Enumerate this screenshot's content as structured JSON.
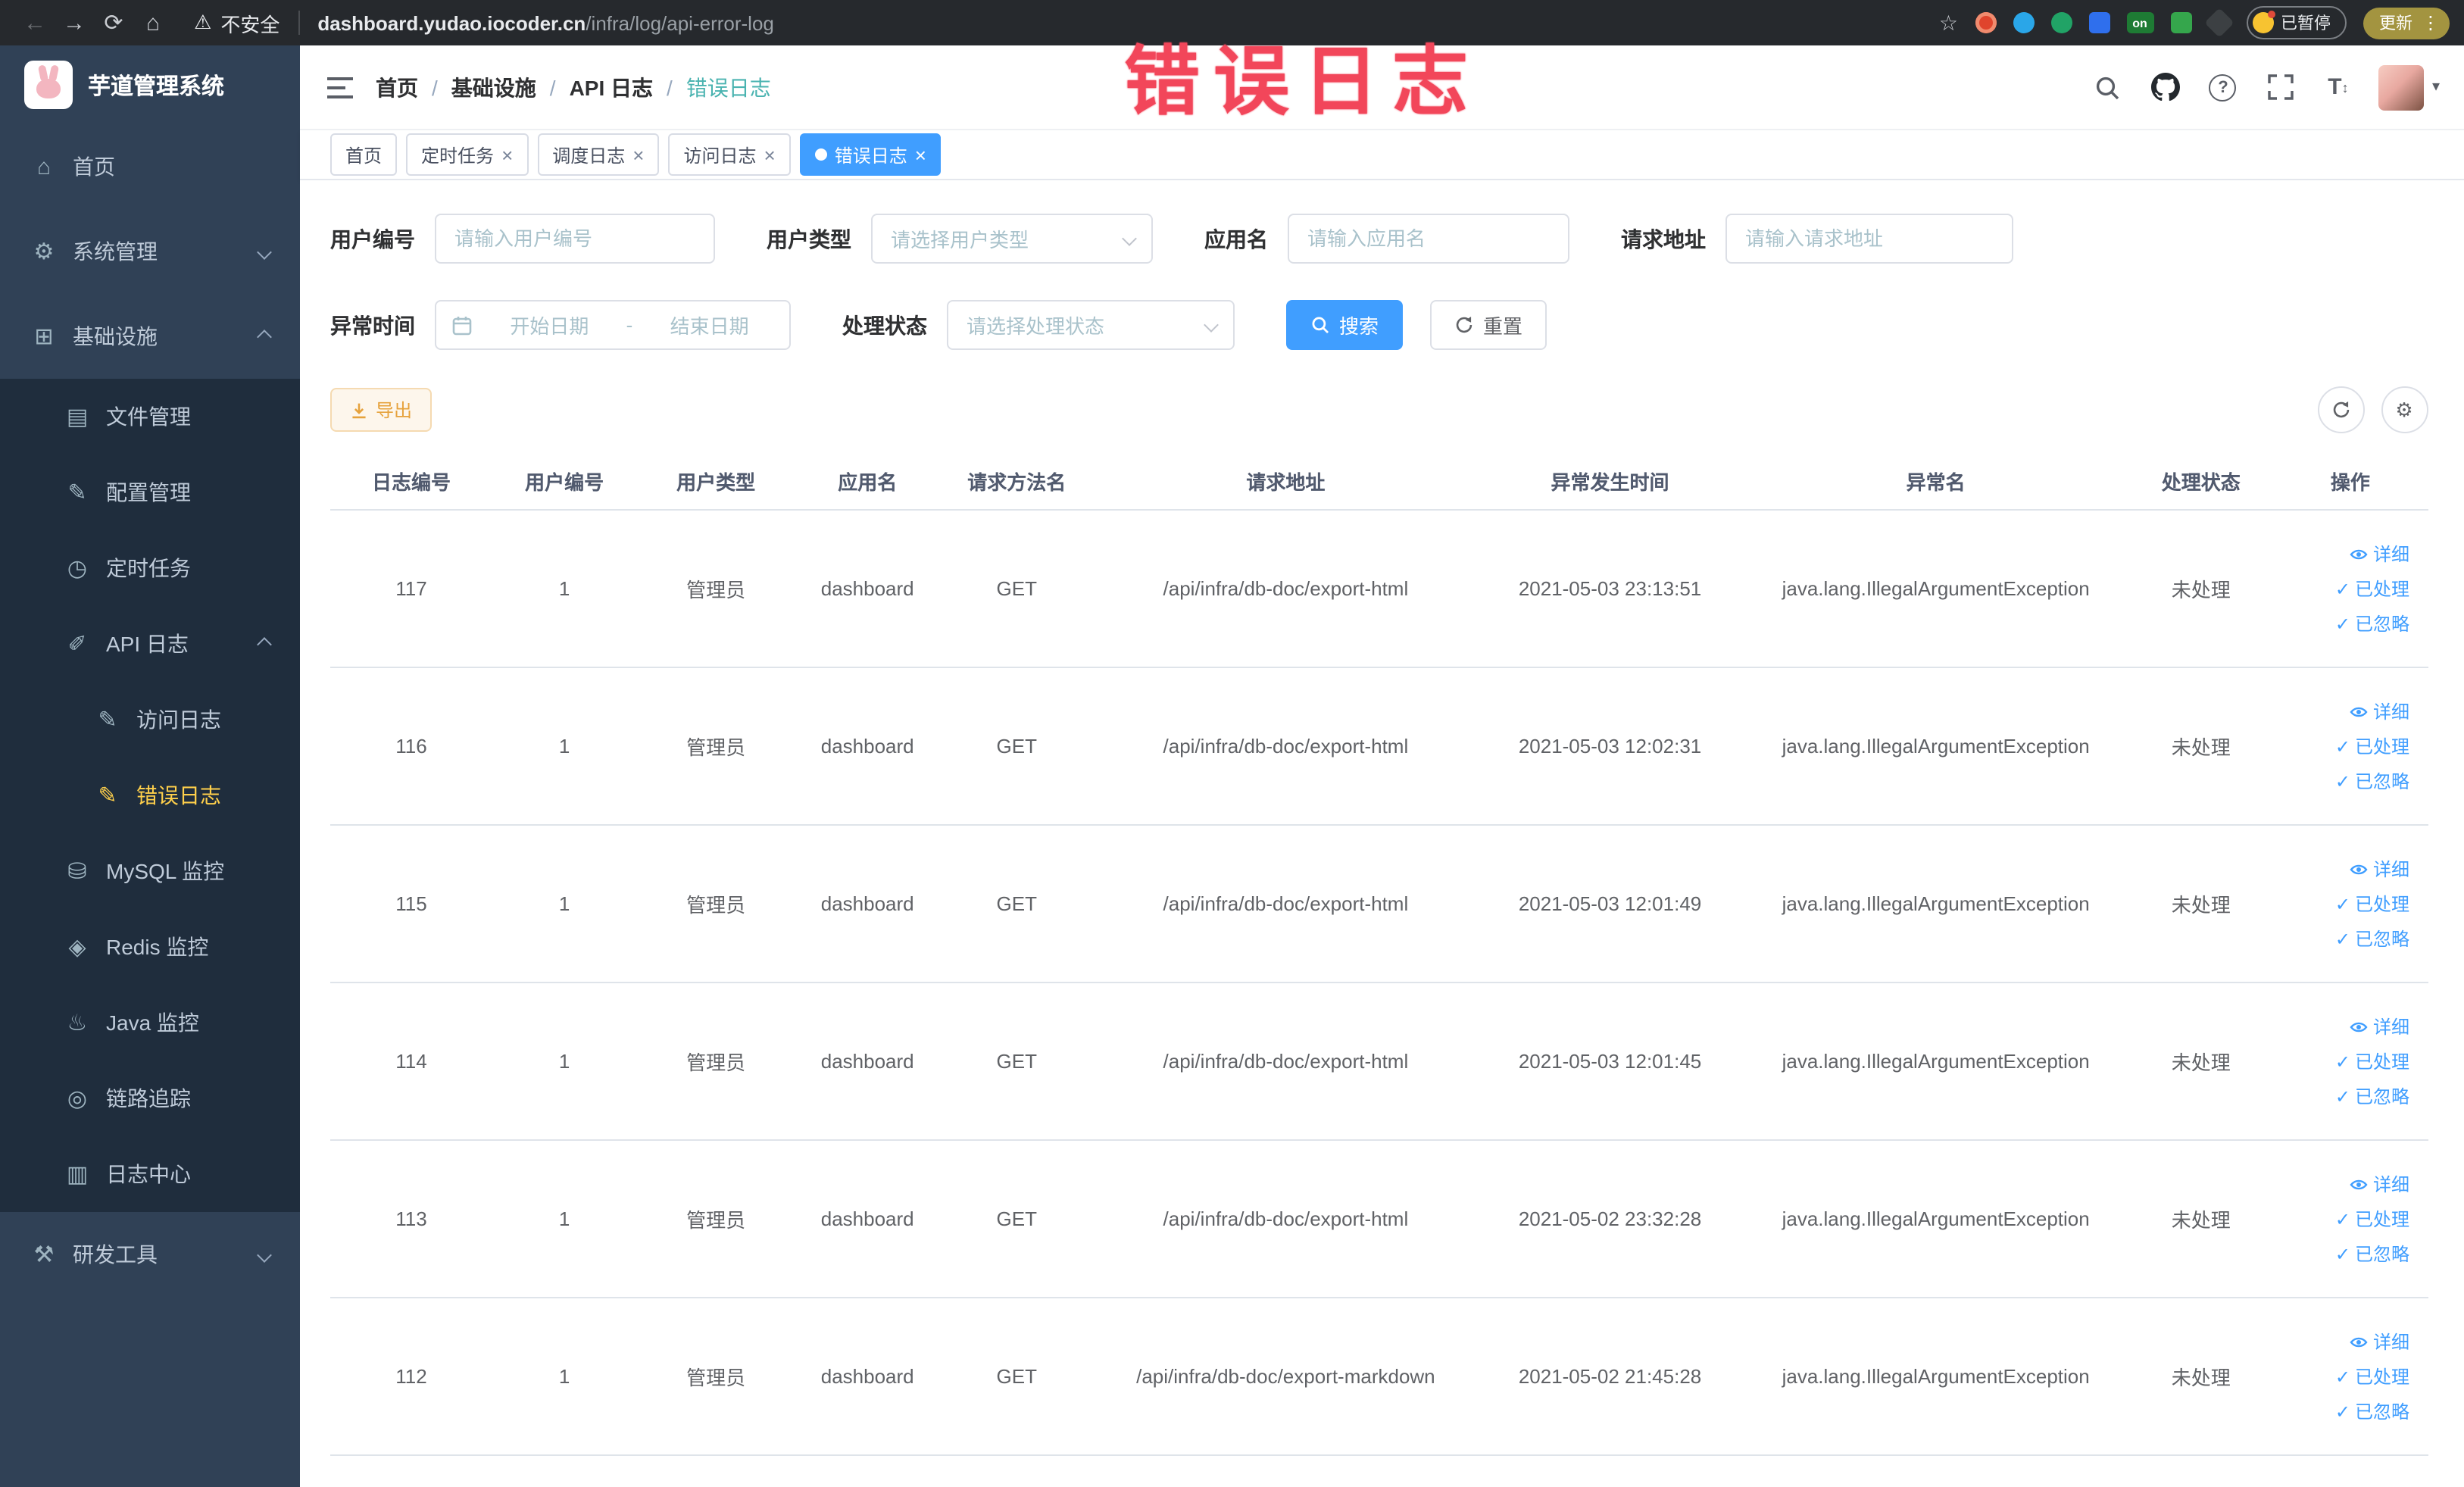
{
  "browser": {
    "security_label": "不安全",
    "url_host": "dashboard.yudao.iocoder.cn",
    "url_path": "/infra/log/api-error-log",
    "extension_on_badge": "on",
    "paused_badge_label": "已暂停",
    "update_button_label": "更新"
  },
  "watermark_text": "错误日志",
  "sidebar": {
    "app_title": "芋道管理系统",
    "items": {
      "home": "首页",
      "system": "系统管理",
      "infra": "基础设施",
      "file": "文件管理",
      "config": "配置管理",
      "job": "定时任务",
      "api_log": "API 日志",
      "access_log": "访问日志",
      "error_log": "错误日志",
      "mysql": "MySQL 监控",
      "redis": "Redis 监控",
      "java": "Java 监控",
      "trace": "链路追踪",
      "log_center": "日志中心",
      "dev_tools": "研发工具"
    }
  },
  "header": {
    "breadcrumb": [
      "首页",
      "基础设施",
      "API 日志",
      "错误日志"
    ]
  },
  "tabs": [
    {
      "label": "首页"
    },
    {
      "label": "定时任务"
    },
    {
      "label": "调度日志"
    },
    {
      "label": "访问日志"
    },
    {
      "label": "错误日志"
    }
  ],
  "filters": {
    "user_id_label": "用户编号",
    "user_id_placeholder": "请输入用户编号",
    "user_type_label": "用户类型",
    "user_type_placeholder": "请选择用户类型",
    "app_name_label": "应用名",
    "app_name_placeholder": "请输入应用名",
    "request_url_label": "请求地址",
    "request_url_placeholder": "请输入请求地址",
    "exception_time_label": "异常时间",
    "date_start_placeholder": "开始日期",
    "date_separator": "-",
    "date_end_placeholder": "结束日期",
    "process_status_label": "处理状态",
    "process_status_placeholder": "请选择处理状态",
    "search_button": "搜索",
    "reset_button": "重置"
  },
  "toolbar": {
    "export_button": "导出"
  },
  "table": {
    "columns": [
      "日志编号",
      "用户编号",
      "用户类型",
      "应用名",
      "请求方法名",
      "请求地址",
      "异常发生时间",
      "异常名",
      "处理状态",
      "操作"
    ],
    "row_actions": [
      "详细",
      "已处理",
      "已忽略"
    ],
    "rows": [
      {
        "id": "117",
        "user_id": "1",
        "user_type": "管理员",
        "app": "dashboard",
        "method": "GET",
        "url": "/api/infra/db-doc/export-html",
        "time": "2021-05-03 23:13:51",
        "exception": "java.lang.IllegalArgumentException",
        "status": "未处理"
      },
      {
        "id": "116",
        "user_id": "1",
        "user_type": "管理员",
        "app": "dashboard",
        "method": "GET",
        "url": "/api/infra/db-doc/export-html",
        "time": "2021-05-03 12:02:31",
        "exception": "java.lang.IllegalArgumentException",
        "status": "未处理"
      },
      {
        "id": "115",
        "user_id": "1",
        "user_type": "管理员",
        "app": "dashboard",
        "method": "GET",
        "url": "/api/infra/db-doc/export-html",
        "time": "2021-05-03 12:01:49",
        "exception": "java.lang.IllegalArgumentException",
        "status": "未处理"
      },
      {
        "id": "114",
        "user_id": "1",
        "user_type": "管理员",
        "app": "dashboard",
        "method": "GET",
        "url": "/api/infra/db-doc/export-html",
        "time": "2021-05-03 12:01:45",
        "exception": "java.lang.IllegalArgumentException",
        "status": "未处理"
      },
      {
        "id": "113",
        "user_id": "1",
        "user_type": "管理员",
        "app": "dashboard",
        "method": "GET",
        "url": "/api/infra/db-doc/export-html",
        "time": "2021-05-02 23:32:28",
        "exception": "java.lang.IllegalArgumentException",
        "status": "未处理"
      },
      {
        "id": "112",
        "user_id": "1",
        "user_type": "管理员",
        "app": "dashboard",
        "method": "GET",
        "url": "/api/infra/db-doc/export-markdown",
        "time": "2021-05-02 21:45:28",
        "exception": "java.lang.IllegalArgumentException",
        "status": "未处理"
      }
    ]
  }
}
